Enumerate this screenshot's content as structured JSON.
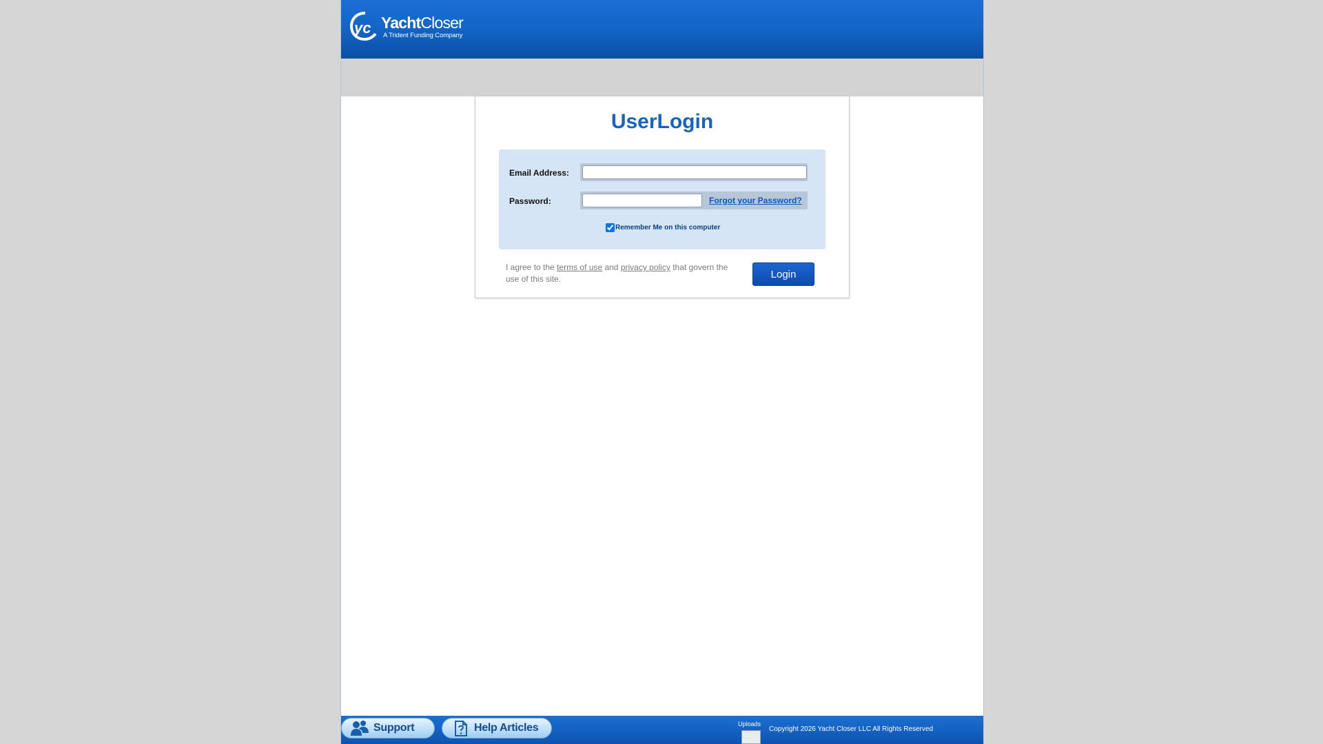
{
  "header": {
    "logo": {
      "mark": "yc",
      "name_bold": "Yacht",
      "name_regular": "Closer",
      "tagline": "A Trident Funding Company"
    }
  },
  "login": {
    "title": "UserLogin",
    "email_label": "Email Address:",
    "email_value": "",
    "password_label": "Password:",
    "password_value": "",
    "forgot_link": "Forgot your Password?",
    "remember_label": "Remember Me on this computer",
    "remember_checked": true,
    "agree_prefix": "I agree to the",
    "terms_link": "terms of use",
    "agree_and": "and",
    "privacy_link": "privacy policy",
    "agree_suffix": "that govern the use of this site.",
    "login_button": "Login"
  },
  "footer": {
    "support_label": "Support",
    "help_label": "Help Articles",
    "uploads_label": "Uploads",
    "copyright": "Copyright 2026 Yacht Closer LLC All Rights Reserved"
  },
  "colors": {
    "header_blue": "#1466c8",
    "title_blue": "#1464c4",
    "form_bg": "#d6e5f5",
    "button_blue": "#0b4bb0",
    "page_bg": "#d6d6d6"
  },
  "icons": [
    "yacht-closer-logo-icon",
    "support-people-icon",
    "help-document-icon",
    "checkbox-checked-icon"
  ]
}
